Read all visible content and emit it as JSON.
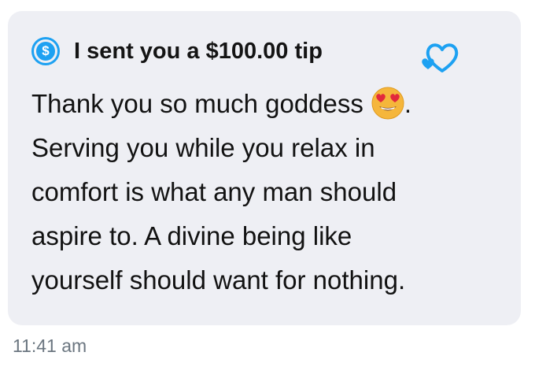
{
  "tip": {
    "icon": "dollar-circle-icon",
    "text": "I sent you a $100.00 tip",
    "accent_color": "#1da1f2",
    "decoration_icon": "sparkle-hearts-icon"
  },
  "message": {
    "lines": [
      "Thank you so much goddess",
      "Serving you while you relax in",
      "comfort is what any man should",
      "aspire to. A divine being like",
      "yourself should want for nothing."
    ],
    "emoji": "heart-eyes-emoji-icon",
    "line1_suffix": ".",
    "bubble_color": "#eeeff4"
  },
  "timestamp": "11:41 am"
}
